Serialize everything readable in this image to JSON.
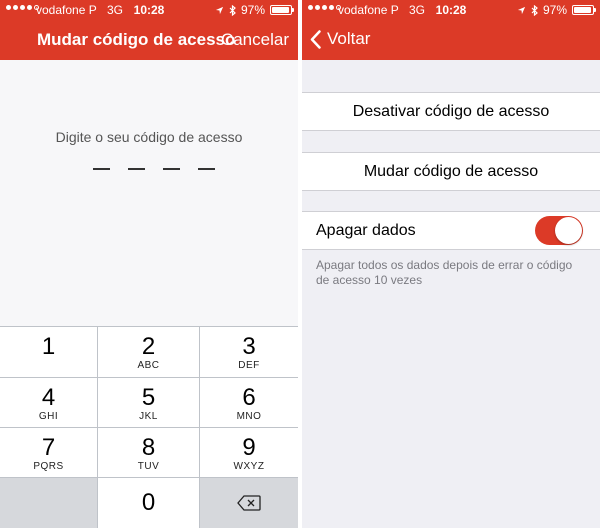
{
  "colors": {
    "accent": "#dc3a27",
    "background": "#efeff4",
    "toggle_on": "#dc3a27"
  },
  "status_bar": {
    "signal_full": 4,
    "signal_total": 5,
    "carrier": "vodafone P",
    "network": "3G",
    "time": "10:28",
    "battery": "97%",
    "battery_level": 0.97,
    "icons": [
      "location-icon",
      "bluetooth-icon",
      "battery-icon"
    ]
  },
  "left_screen": {
    "title": "Mudar código de acesso",
    "cancel_label": "Cancelar",
    "prompt": "Digite o seu código de acesso",
    "passcode_length": 4,
    "keypad": [
      {
        "num": "1",
        "letters": ""
      },
      {
        "num": "2",
        "letters": "ABC"
      },
      {
        "num": "3",
        "letters": "DEF"
      },
      {
        "num": "4",
        "letters": "GHI"
      },
      {
        "num": "5",
        "letters": "JKL"
      },
      {
        "num": "6",
        "letters": "MNO"
      },
      {
        "num": "7",
        "letters": "PQRS"
      },
      {
        "num": "8",
        "letters": "TUV"
      },
      {
        "num": "9",
        "letters": "WXYZ"
      },
      {
        "num": "0",
        "letters": ""
      }
    ],
    "delete_icon": "backspace-icon"
  },
  "right_screen": {
    "back_label": "Voltar",
    "back_icon": "chevron-left-icon",
    "items": {
      "disable": "Desativar código de acesso",
      "change": "Mudar código de acesso",
      "erase": "Apagar dados"
    },
    "erase_toggle_on": true,
    "footnote": "Apagar todos os dados depois de errar o código de acesso 10 vezes"
  }
}
